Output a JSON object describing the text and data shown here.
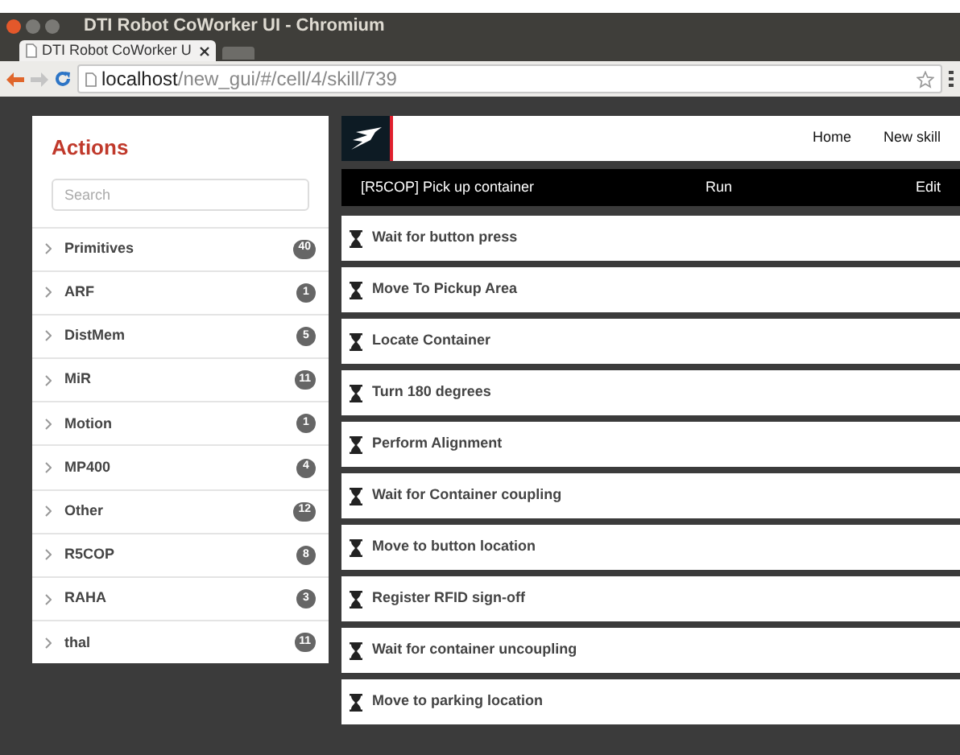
{
  "window": {
    "title": "DTI Robot CoWorker UI - Chromium"
  },
  "tabs": [
    {
      "label": "DTI Robot CoWorker U",
      "selected": true
    }
  ],
  "address_bar": {
    "host": "localhost",
    "path": "/new_gui/#/cell/4/skill/739"
  },
  "sidebar": {
    "title": "Actions",
    "search": {
      "placeholder": "Search"
    },
    "items": [
      {
        "label": "Primitives",
        "count": "40"
      },
      {
        "label": "ARF",
        "count": "1"
      },
      {
        "label": "DistMem",
        "count": "5"
      },
      {
        "label": "MiR",
        "count": "11"
      },
      {
        "label": "Motion",
        "count": "1"
      },
      {
        "label": "MP400",
        "count": "4"
      },
      {
        "label": "Other",
        "count": "12"
      },
      {
        "label": "R5COP",
        "count": "8"
      },
      {
        "label": "RAHA",
        "count": "3"
      },
      {
        "label": "thal",
        "count": "11"
      }
    ]
  },
  "nav": [
    "Home",
    "New skill"
  ],
  "skill_bar": {
    "title": "[R5COP] Pick up container",
    "run": "Run",
    "edit": "Edit"
  },
  "steps": [
    "Wait for button press",
    "Move To Pickup Area",
    "Locate Container",
    "Turn 180 degrees",
    "Perform Alignment",
    "Wait for Container coupling",
    "Move to button location",
    "Register RFID sign-off",
    "Wait for container uncoupling",
    "Move to parking location"
  ]
}
